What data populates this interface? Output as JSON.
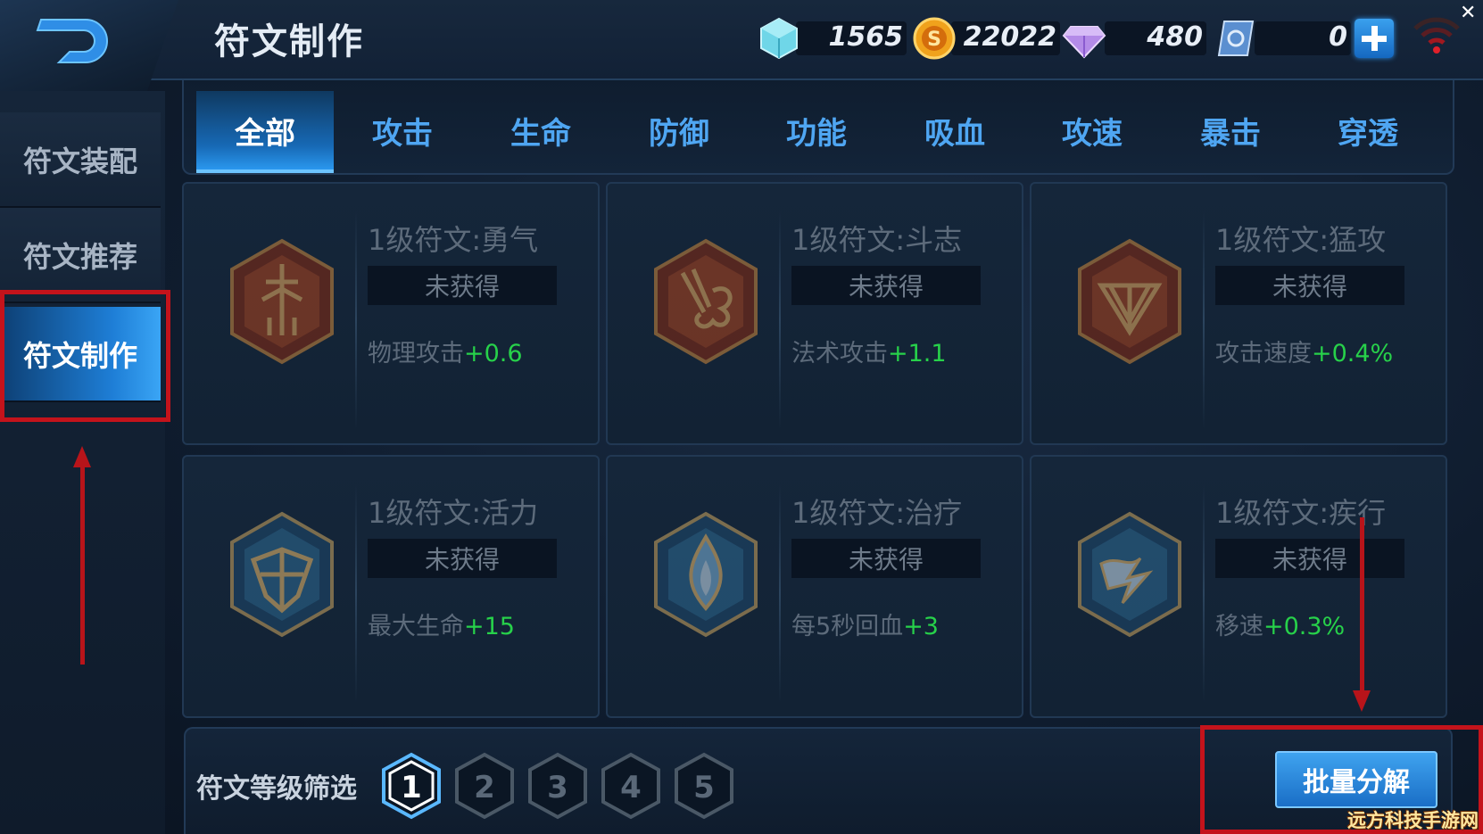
{
  "header": {
    "title": "符文制作",
    "currencies": [
      {
        "icon": "crystal-icon",
        "value": "1565"
      },
      {
        "icon": "gold-coin-icon",
        "value": "22022"
      },
      {
        "icon": "diamond-icon",
        "value": "480"
      },
      {
        "icon": "voucher-icon",
        "value": "0"
      }
    ]
  },
  "sidebar": {
    "items": [
      {
        "label": "符文装配"
      },
      {
        "label": "符文推荐"
      },
      {
        "label": "符文制作"
      }
    ],
    "active_index": 2
  },
  "tabs": {
    "items": [
      "全部",
      "攻击",
      "生命",
      "防御",
      "功能",
      "吸血",
      "攻速",
      "暴击",
      "穿透"
    ],
    "active_index": 0
  },
  "runes": [
    {
      "title": "1级符文:勇气",
      "status": "未获得",
      "attr_name": "物理攻击",
      "attr_value": "+0.6",
      "icon": "courage-rune-icon",
      "color": "red"
    },
    {
      "title": "1级符文:斗志",
      "status": "未获得",
      "attr_name": "法术攻击",
      "attr_value": "+1.1",
      "icon": "fighting-spirit-rune-icon",
      "color": "red"
    },
    {
      "title": "1级符文:猛攻",
      "status": "未获得",
      "attr_name": "攻击速度",
      "attr_value": "+0.4%",
      "icon": "assault-rune-icon",
      "color": "red"
    },
    {
      "title": "1级符文:活力",
      "status": "未获得",
      "attr_name": "最大生命",
      "attr_value": "+15",
      "icon": "vitality-rune-icon",
      "color": "blue"
    },
    {
      "title": "1级符文:治疗",
      "status": "未获得",
      "attr_name": "每5秒回血",
      "attr_value": "+3",
      "icon": "healing-rune-icon",
      "color": "blue"
    },
    {
      "title": "1级符文:疾行",
      "status": "未获得",
      "attr_name": "移速",
      "attr_value": "+0.3%",
      "icon": "swift-rune-icon",
      "color": "blue"
    }
  ],
  "filter": {
    "label": "符文等级筛选",
    "levels": [
      "1",
      "2",
      "3",
      "4",
      "5"
    ],
    "active_level": "1"
  },
  "batch_button": {
    "label": "批量分解"
  },
  "watermark": "远方科技手游网",
  "colors": {
    "accent": "#2a97ee",
    "highlight_red": "#c4131b",
    "attr_green": "#27d14a"
  }
}
